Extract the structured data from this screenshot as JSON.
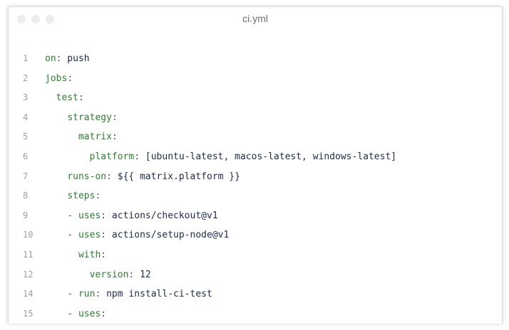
{
  "window": {
    "title": "ci.yml"
  },
  "editor": {
    "lines": [
      {
        "number": "1",
        "indent": "",
        "dash": "",
        "key": "on",
        "colon": ":",
        "value": " push"
      },
      {
        "number": "2",
        "indent": "",
        "dash": "",
        "key": "jobs",
        "colon": ":",
        "value": ""
      },
      {
        "number": "3",
        "indent": "  ",
        "dash": "",
        "key": "test",
        "colon": ":",
        "value": ""
      },
      {
        "number": "4",
        "indent": "    ",
        "dash": "",
        "key": "strategy",
        "colon": ":",
        "value": ""
      },
      {
        "number": "5",
        "indent": "      ",
        "dash": "",
        "key": "matrix",
        "colon": ":",
        "value": ""
      },
      {
        "number": "6",
        "indent": "        ",
        "dash": "",
        "key": "platform",
        "colon": ":",
        "value": " [ubuntu-latest, macos-latest, windows-latest]"
      },
      {
        "number": "7",
        "indent": "    ",
        "dash": "",
        "key": "runs-on",
        "colon": ":",
        "value": " ${{ matrix.platform }}"
      },
      {
        "number": "8",
        "indent": "    ",
        "dash": "",
        "key": "steps",
        "colon": ":",
        "value": ""
      },
      {
        "number": "9",
        "indent": "    ",
        "dash": "- ",
        "key": "uses",
        "colon": ":",
        "value": " actions/checkout@v1"
      },
      {
        "number": "10",
        "indent": "    ",
        "dash": "- ",
        "key": "uses",
        "colon": ":",
        "value": " actions/setup-node@v1"
      },
      {
        "number": "11",
        "indent": "      ",
        "dash": "",
        "key": "with",
        "colon": ":",
        "value": ""
      },
      {
        "number": "12",
        "indent": "        ",
        "dash": "",
        "key": "version",
        "colon": ":",
        "value": " 12"
      },
      {
        "number": "14",
        "indent": "    ",
        "dash": "- ",
        "key": "run",
        "colon": ":",
        "value": " npm install-ci-test"
      },
      {
        "number": "15",
        "indent": "    ",
        "dash": "- ",
        "key": "uses",
        "colon": ":",
        "value": ""
      }
    ]
  },
  "colors": {
    "key": "#2e7d32",
    "value": "#1b2b4b",
    "line_number": "#9aa0a6"
  }
}
